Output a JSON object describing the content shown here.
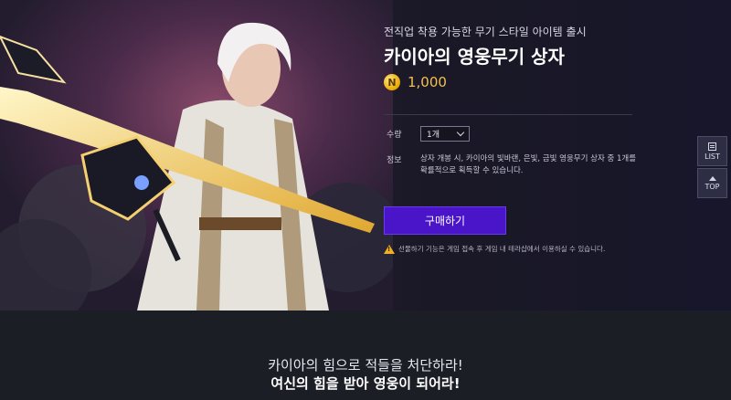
{
  "product": {
    "subtitle": "전직업 착용 가능한 무기 스타일 아이템 출시",
    "title": "카이아의 영웅무기 상자",
    "coin_symbol": "N",
    "price": "1,000"
  },
  "options": {
    "quantity_label": "수량",
    "quantity_value": "1개",
    "info_label": "정보",
    "info_text": "상자 개봉 시, 카이아의 빛바랜, 은빛, 금빛 영웅무기 상자 중 1개를 확률적으로 획득할 수 있습니다."
  },
  "buy_label": "구매하기",
  "notice": "선물하기 기능은 게임 접속 후 게임 내 테라샵에서 이용하실 수 있습니다.",
  "side_nav": {
    "list": "LIST",
    "top": "TOP"
  },
  "footer": {
    "line1": "카이아의 힘으로 적들을 처단하라!",
    "line2": "여신의 힘을 받아 영웅이 되어라!"
  },
  "colors": {
    "accent": "#4a14c8",
    "price": "#f2c14e",
    "background": "#1b1d26"
  }
}
